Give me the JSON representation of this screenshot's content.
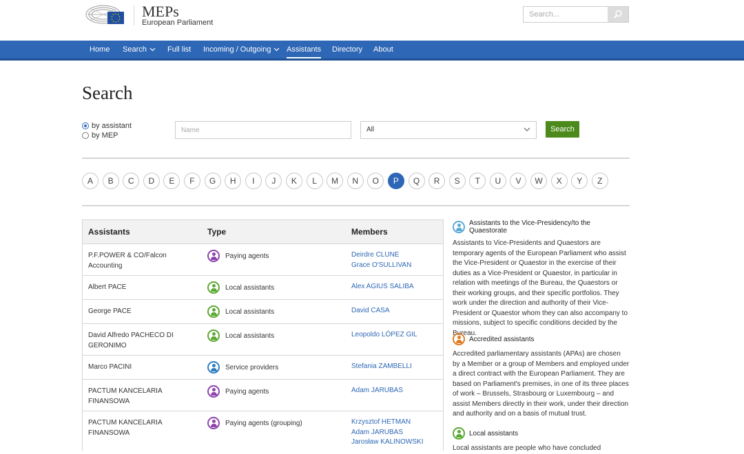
{
  "header": {
    "title": "MEPs",
    "subtitle": "European Parliament",
    "search_placeholder": "Search..."
  },
  "nav": {
    "items": [
      {
        "label": "Home"
      },
      {
        "label": "Search"
      },
      {
        "label": "Full list"
      },
      {
        "label": "Incoming / Outgoing"
      },
      {
        "label": "Assistants"
      },
      {
        "label": "Directory"
      },
      {
        "label": "About"
      }
    ],
    "active": "Assistants"
  },
  "page": {
    "title": "Search",
    "radio_by_assistant": "by assistant",
    "radio_by_mep": "by MEP",
    "name_placeholder": "Name",
    "type_select_value": "All",
    "search_button": "Search"
  },
  "letters": [
    "A",
    "B",
    "C",
    "D",
    "E",
    "F",
    "G",
    "H",
    "I",
    "J",
    "K",
    "L",
    "M",
    "N",
    "O",
    "P",
    "Q",
    "R",
    "S",
    "T",
    "U",
    "V",
    "W",
    "X",
    "Y",
    "Z"
  ],
  "active_letter": "P",
  "table": {
    "headers": {
      "assistants": "Assistants",
      "type": "Type",
      "members": "Members"
    },
    "rows": [
      {
        "name": "P.F.POWER & CO/Falcon Accounting",
        "type": "Paying agents",
        "type_color": "#8e44ad",
        "members": [
          "Deirdre CLUNE",
          "Grace O'SULLIVAN"
        ]
      },
      {
        "name": "Albert PACE",
        "type": "Local assistants",
        "type_color": "#5aa832",
        "members": [
          "Alex AGIUS SALIBA"
        ]
      },
      {
        "name": "George PACE",
        "type": "Local assistants",
        "type_color": "#5aa832",
        "members": [
          "David CASA"
        ]
      },
      {
        "name": "David Alfredo PACHECO DI GERONIMO",
        "type": "Local assistants",
        "type_color": "#5aa832",
        "members": [
          "Leopoldo LÓPEZ GIL"
        ]
      },
      {
        "name": "Marco PACINI",
        "type": "Service providers",
        "type_color": "#2e7fc1",
        "members": [
          "Stefania ZAMBELLI"
        ]
      },
      {
        "name": "PACTUM KANCELARIA FINANSOWA",
        "type": "Paying agents",
        "type_color": "#8e44ad",
        "members": [
          "Adam JARUBAS"
        ]
      },
      {
        "name": "PACTUM KANCELARIA FINANSOWA",
        "type": "Paying agents (grouping)",
        "type_color": "#8e44ad",
        "members": [
          "Krzysztof HETMAN",
          "Adam JARUBAS",
          "Jarosław KALINOWSKI"
        ]
      }
    ]
  },
  "info": [
    {
      "title": "Assistants to the Vice-Presidency/to the Quaestorate",
      "color": "#5aa9d6",
      "text": "Assistants to Vice-Presidents and Quaestors are temporary agents of the European Parliament who assist the Vice-President or Quaestor in the exercise of their duties as a Vice-President or Quaestor, in particular in relation with meetings of the Bureau, the Quaestors or their working groups, and their specific portfolios. They work under the direction and authority of their Vice-President or Quaestor whom they can also accompany to missions, subject to specific conditions decided by the Bureau."
    },
    {
      "title": "Accredited assistants",
      "color": "#e07b24",
      "text": "Accredited parliamentary assistants (APAs) are chosen by a Member or a group of Members and employed under a direct contract with the European Parliament. They are based on Parliament's premises, in one of its three places of work – Brussels, Strasbourg or Luxembourg – and assist Members directly in their work, under their direction and authority and on a basis of mutual trust."
    },
    {
      "title": "Local assistants",
      "color": "#5aa832",
      "text": "Local assistants are people who have concluded"
    }
  ]
}
